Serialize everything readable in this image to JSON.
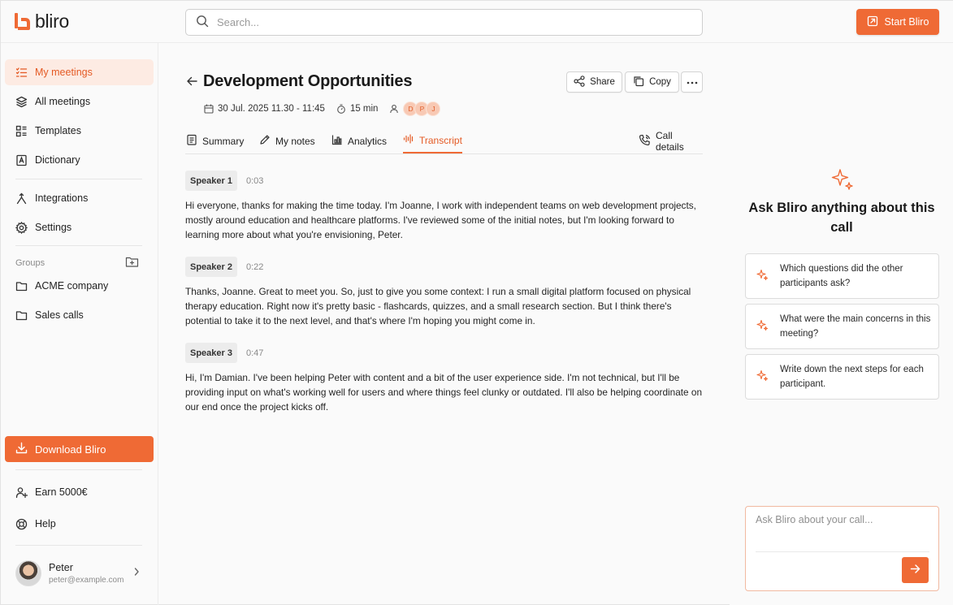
{
  "app": {
    "name": "bliro",
    "brand_color": "#ef6a35"
  },
  "search": {
    "placeholder": "Search..."
  },
  "header": {
    "start_label": "Start Bliro"
  },
  "sidebar": {
    "nav": [
      {
        "label": "My meetings",
        "icon": "list-icon",
        "active": true
      },
      {
        "label": "All meetings",
        "icon": "layers-icon"
      },
      {
        "label": "Templates",
        "icon": "templates-icon"
      },
      {
        "label": "Dictionary",
        "icon": "dictionary-icon"
      },
      {
        "label": "Integrations",
        "icon": "integrations-icon"
      },
      {
        "label": "Settings",
        "icon": "gear-icon"
      }
    ],
    "groups_label": "Groups",
    "groups": [
      {
        "label": "ACME company",
        "icon": "folder-icon"
      },
      {
        "label": "Sales calls",
        "icon": "folder-icon"
      }
    ],
    "download_label": "Download Bliro",
    "earn_label": "Earn 5000€",
    "help_label": "Help",
    "user": {
      "name": "Peter",
      "email": "peter@example.com"
    }
  },
  "meeting": {
    "title": "Development Opportunities",
    "share_label": "Share",
    "copy_label": "Copy",
    "date": "30 Jul. 2025 11.30 - 11:45",
    "duration": "15 min",
    "participants": [
      "D",
      "P",
      "J"
    ],
    "tabs": [
      {
        "label": "Summary",
        "icon": "document-icon"
      },
      {
        "label": "My notes",
        "icon": "pencil-icon"
      },
      {
        "label": "Analytics",
        "icon": "bar-chart-icon"
      },
      {
        "label": "Transcript",
        "icon": "waveform-icon",
        "active": true
      }
    ],
    "call_details_label": "Call details"
  },
  "transcript": [
    {
      "speaker": "Speaker 1",
      "time": "0:03",
      "text": "Hi everyone, thanks for making the time today. I'm Joanne, I work with independent teams on web development projects, mostly around education and healthcare platforms. I've reviewed some of the initial notes, but I'm looking forward to learning more about what you're envisioning, Peter."
    },
    {
      "speaker": "Speaker 2",
      "time": "0:22",
      "text": "Thanks, Joanne. Great to meet you. So, just to give you some context: I run a small digital platform focused on physical therapy education. Right now it's pretty basic - flashcards, quizzes, and a small research section. But I think there's potential to take it to the next level, and that's where I'm hoping you might come in."
    },
    {
      "speaker": "Speaker 3",
      "time": "0:47",
      "text": "Hi, I'm Damian. I've been helping Peter with content and a bit of the user experience side. I'm not technical, but I'll be providing input on what's working well for users and where things feel clunky or outdated. I'll also be helping coordinate on our end once the project kicks off."
    }
  ],
  "assistant": {
    "title": "Ask Bliro anything about this call",
    "suggestions": [
      "Which questions did the other participants ask?",
      "What were the main concerns in this meeting?",
      "Write down the next steps for each participant."
    ],
    "input_placeholder": "Ask Bliro about your call..."
  }
}
